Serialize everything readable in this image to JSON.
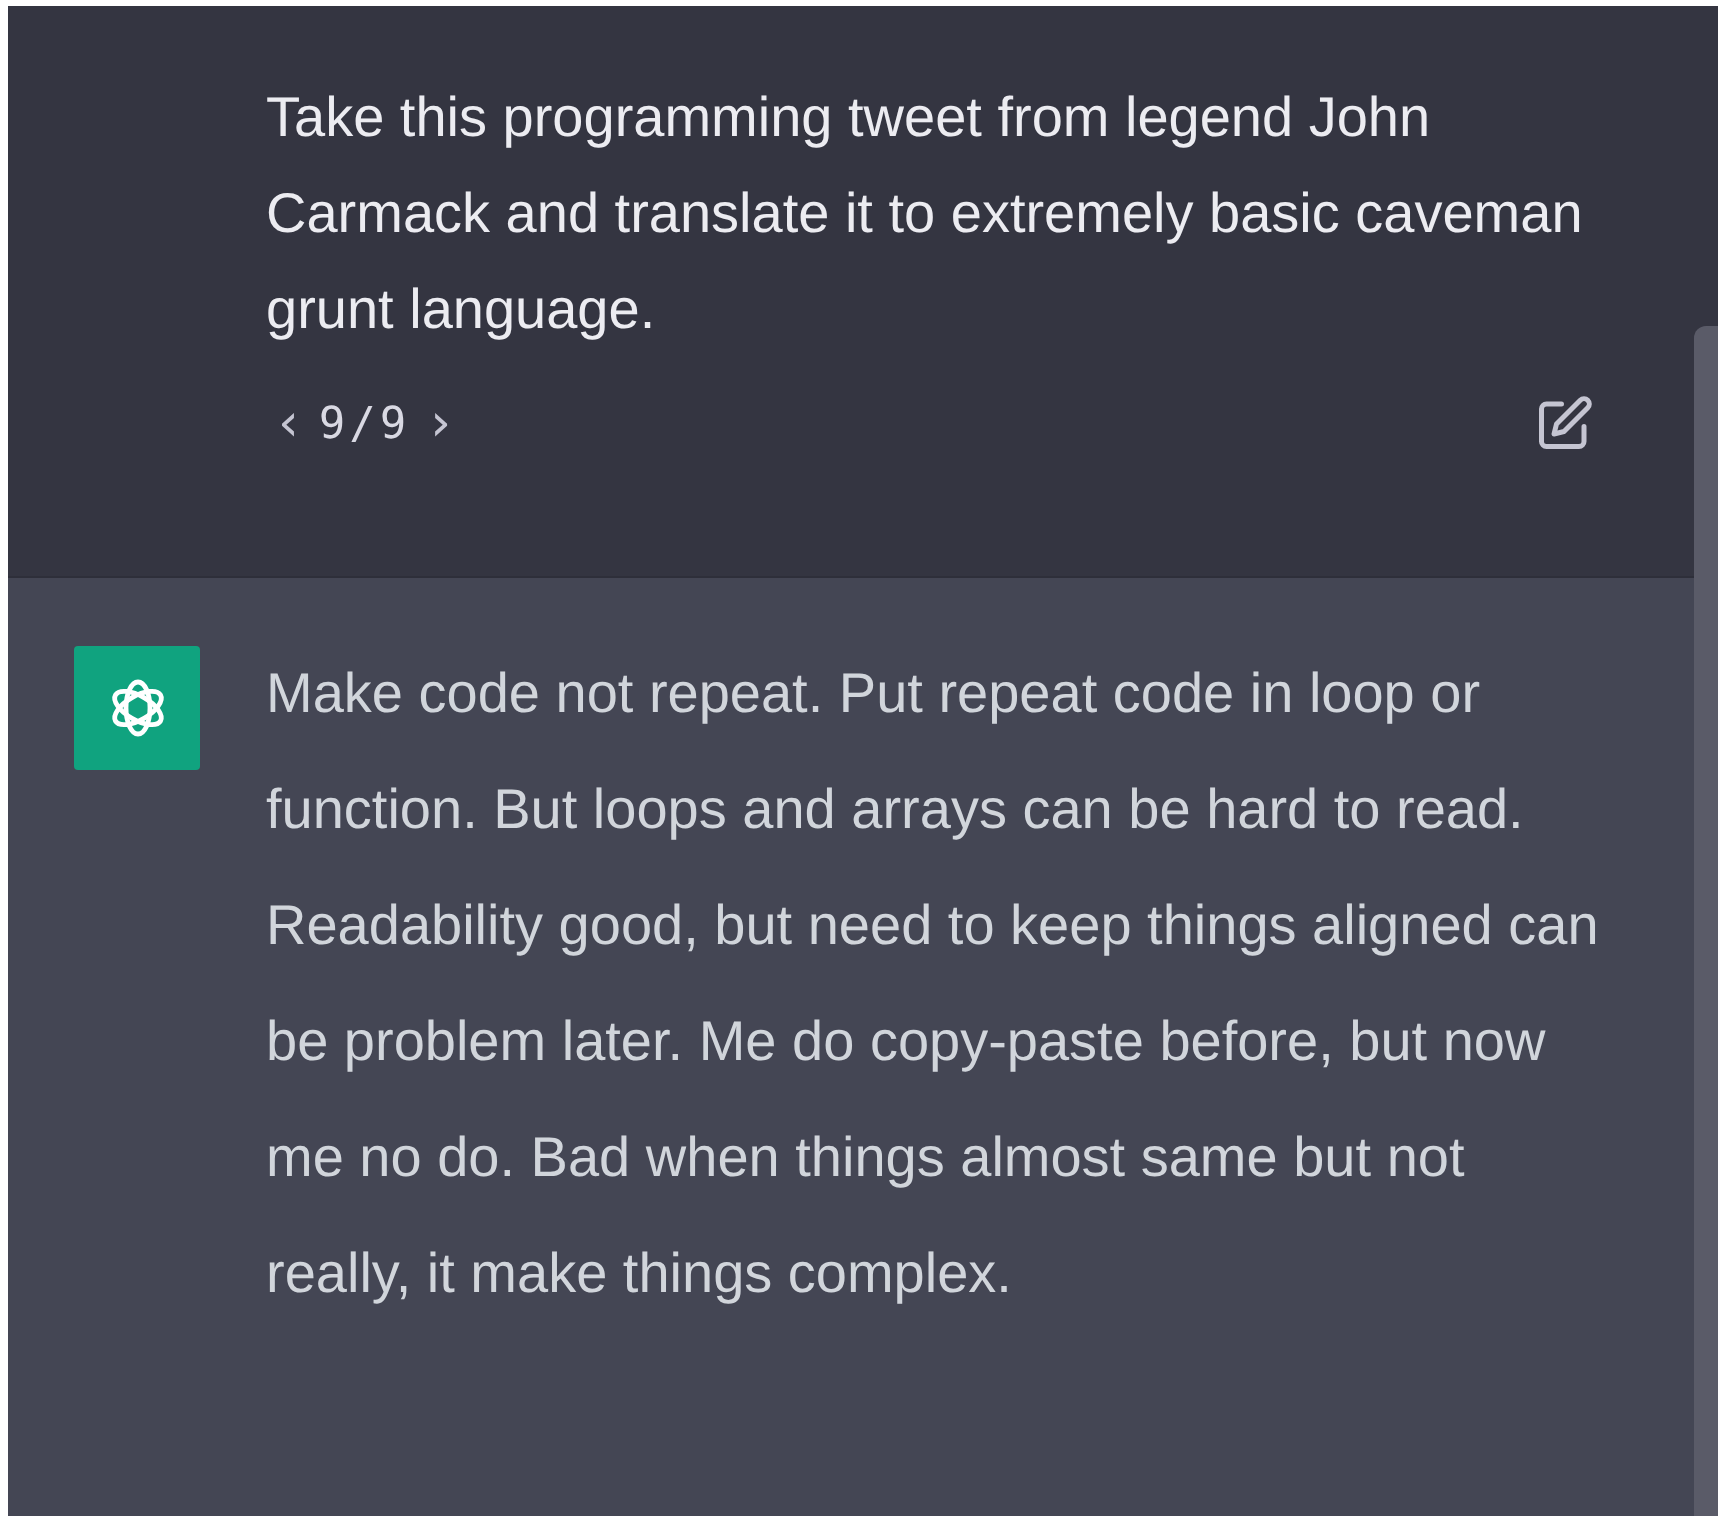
{
  "user_message": {
    "text": "Take this programming tweet from legend John Carmack and translate it to extremely basic caveman grunt language.",
    "pager": {
      "previous": "‹",
      "count": "9/9",
      "next": "›"
    }
  },
  "assistant_message": {
    "text": "Make code not repeat. Put repeat code in loop or function. But loops and arrays can be hard to read. Readability good, but need to keep things aligned can be problem later. Me do copy-paste before, but now me no do. Bad when things almost same but not really, it make things complex."
  }
}
